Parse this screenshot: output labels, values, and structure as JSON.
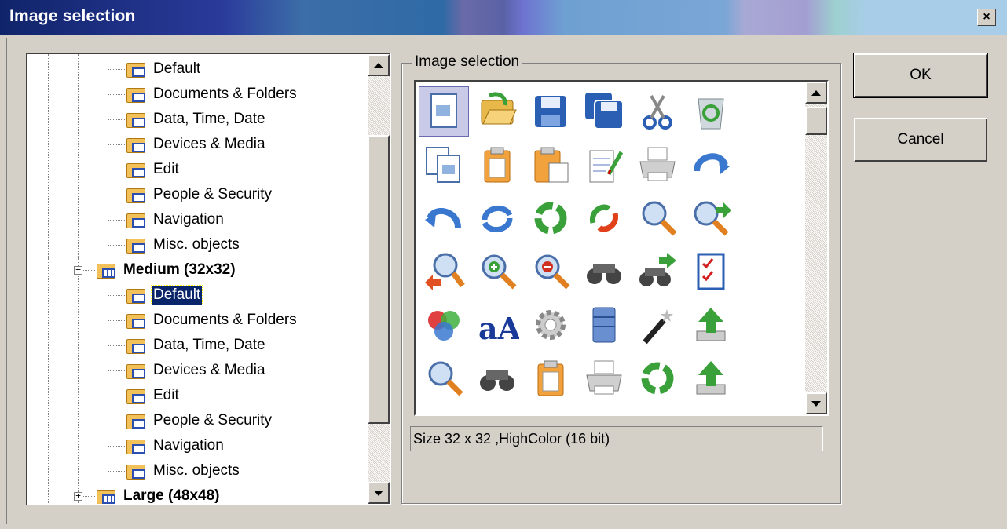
{
  "window": {
    "title": "Image selection",
    "close_glyph": "×"
  },
  "tree": {
    "rows": [
      {
        "label": "Default"
      },
      {
        "label": "Documents & Folders"
      },
      {
        "label": "Data, Time, Date"
      },
      {
        "label": "Devices & Media"
      },
      {
        "label": "Edit"
      },
      {
        "label": "People & Security"
      },
      {
        "label": "Navigation"
      },
      {
        "label": "Misc. objects"
      },
      {
        "label": "Medium (32x32)",
        "expander": "−"
      },
      {
        "label": "Default"
      },
      {
        "label": "Documents & Folders"
      },
      {
        "label": "Data, Time, Date"
      },
      {
        "label": "Devices & Media"
      },
      {
        "label": "Edit"
      },
      {
        "label": "People & Security"
      },
      {
        "label": "Navigation"
      },
      {
        "label": "Misc. objects"
      },
      {
        "label": "Large (48x48)",
        "expander": "+"
      }
    ],
    "selected_index": 9
  },
  "image_selection": {
    "group_label": "Image selection",
    "status": "Size 32 x 32 ,HighColor (16 bit)",
    "icons": [
      "new-document-icon",
      "open-folder-icon",
      "save-icon",
      "save-all-icon",
      "cut-icon",
      "recycle-bin-icon",
      "copy-icon",
      "paste-icon",
      "paste-special-icon",
      "notepad-edit-icon",
      "print-icon",
      "redo-icon",
      "undo-icon",
      "refresh-icon",
      "recycle-arrows-icon",
      "swap-arrows-icon",
      "search-icon",
      "find-next-icon",
      "find-previous-icon",
      "zoom-in-icon",
      "zoom-out-icon",
      "binoculars-icon",
      "binoculars-next-icon",
      "checklist-icon",
      "color-circles-icon",
      "font-icon",
      "gear-icon",
      "server-icon",
      "magic-wand-icon",
      "upload-icon"
    ],
    "selected_index": 0
  },
  "buttons": {
    "ok": "OK",
    "cancel": "Cancel"
  }
}
